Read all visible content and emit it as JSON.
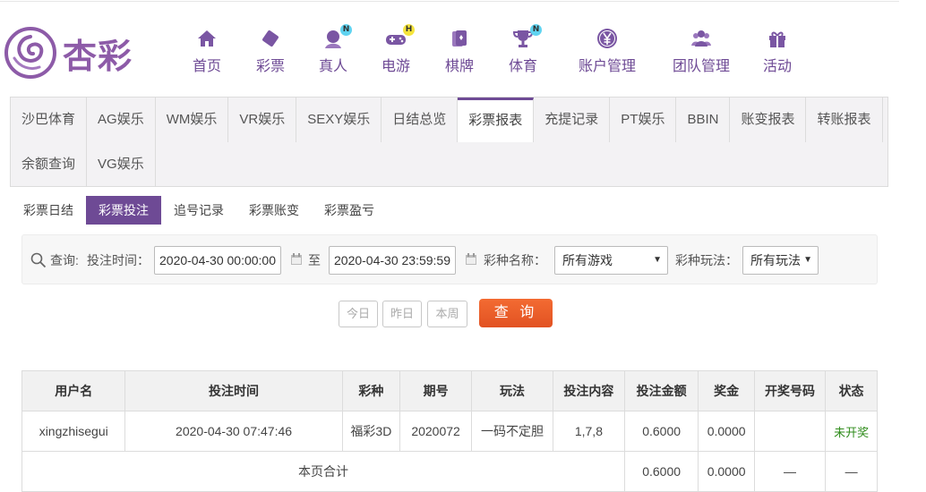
{
  "brand": {
    "logo_text": "杏彩"
  },
  "nav": [
    {
      "label": "首页",
      "icon": "home-icon"
    },
    {
      "label": "彩票",
      "icon": "lottery-ticket-icon"
    },
    {
      "label": "真人",
      "icon": "live-dealer-icon",
      "badge": "N"
    },
    {
      "label": "电游",
      "icon": "gamepad-icon",
      "badge": "H"
    },
    {
      "label": "棋牌",
      "icon": "cards-icon"
    },
    {
      "label": "体育",
      "icon": "trophy-icon",
      "badge": "N"
    },
    {
      "label": "账户管理",
      "icon": "yen-icon"
    },
    {
      "label": "团队管理",
      "icon": "team-icon"
    },
    {
      "label": "活动",
      "icon": "gift-icon"
    }
  ],
  "tabs_row1": [
    "沙巴体育",
    "AG娱乐",
    "WM娱乐",
    "VR娱乐",
    "SEXY娱乐",
    "日结总览",
    "彩票报表",
    "充提记录",
    "PT娱乐",
    "BBIN",
    "账变报表",
    "转账报表"
  ],
  "tabs_row2": [
    "余额查询",
    "VG娱乐"
  ],
  "active_tab": "彩票报表",
  "sub_tabs": [
    "彩票日结",
    "彩票投注",
    "追号记录",
    "彩票账变",
    "彩票盈亏"
  ],
  "active_sub_tab": "彩票投注",
  "query": {
    "label": "查询:",
    "time_label": "投注时间：",
    "start_time": "2020-04-30 00:00:00",
    "to_label": "至",
    "end_time": "2020-04-30 23:59:59",
    "game_label": "彩种名称：",
    "game_value": "所有游戏",
    "play_label": "彩种玩法：",
    "play_value": "所有玩法"
  },
  "quick_buttons": {
    "today": "今日",
    "yesterday": "昨日",
    "week": "本周"
  },
  "search_button": "查 询",
  "table": {
    "headers": [
      "用户名",
      "投注时间",
      "彩种",
      "期号",
      "玩法",
      "投注内容",
      "投注金额",
      "奖金",
      "开奖号码",
      "状态"
    ],
    "rows": [
      [
        "xingzhisegui",
        "2020-04-30 07:47:46",
        "福彩3D",
        "2020072",
        "一码不定胆",
        "1,7,8",
        "0.6000",
        "0.0000",
        "",
        "未开奖"
      ]
    ],
    "footer": {
      "label": "本页合计",
      "amount": "0.6000",
      "bonus": "0.0000",
      "draw": "—",
      "status": "—"
    }
  },
  "colors": {
    "brand_purple": "#6e4a95",
    "search_orange": "#e8582a",
    "status_green": "#2e8b1a"
  }
}
